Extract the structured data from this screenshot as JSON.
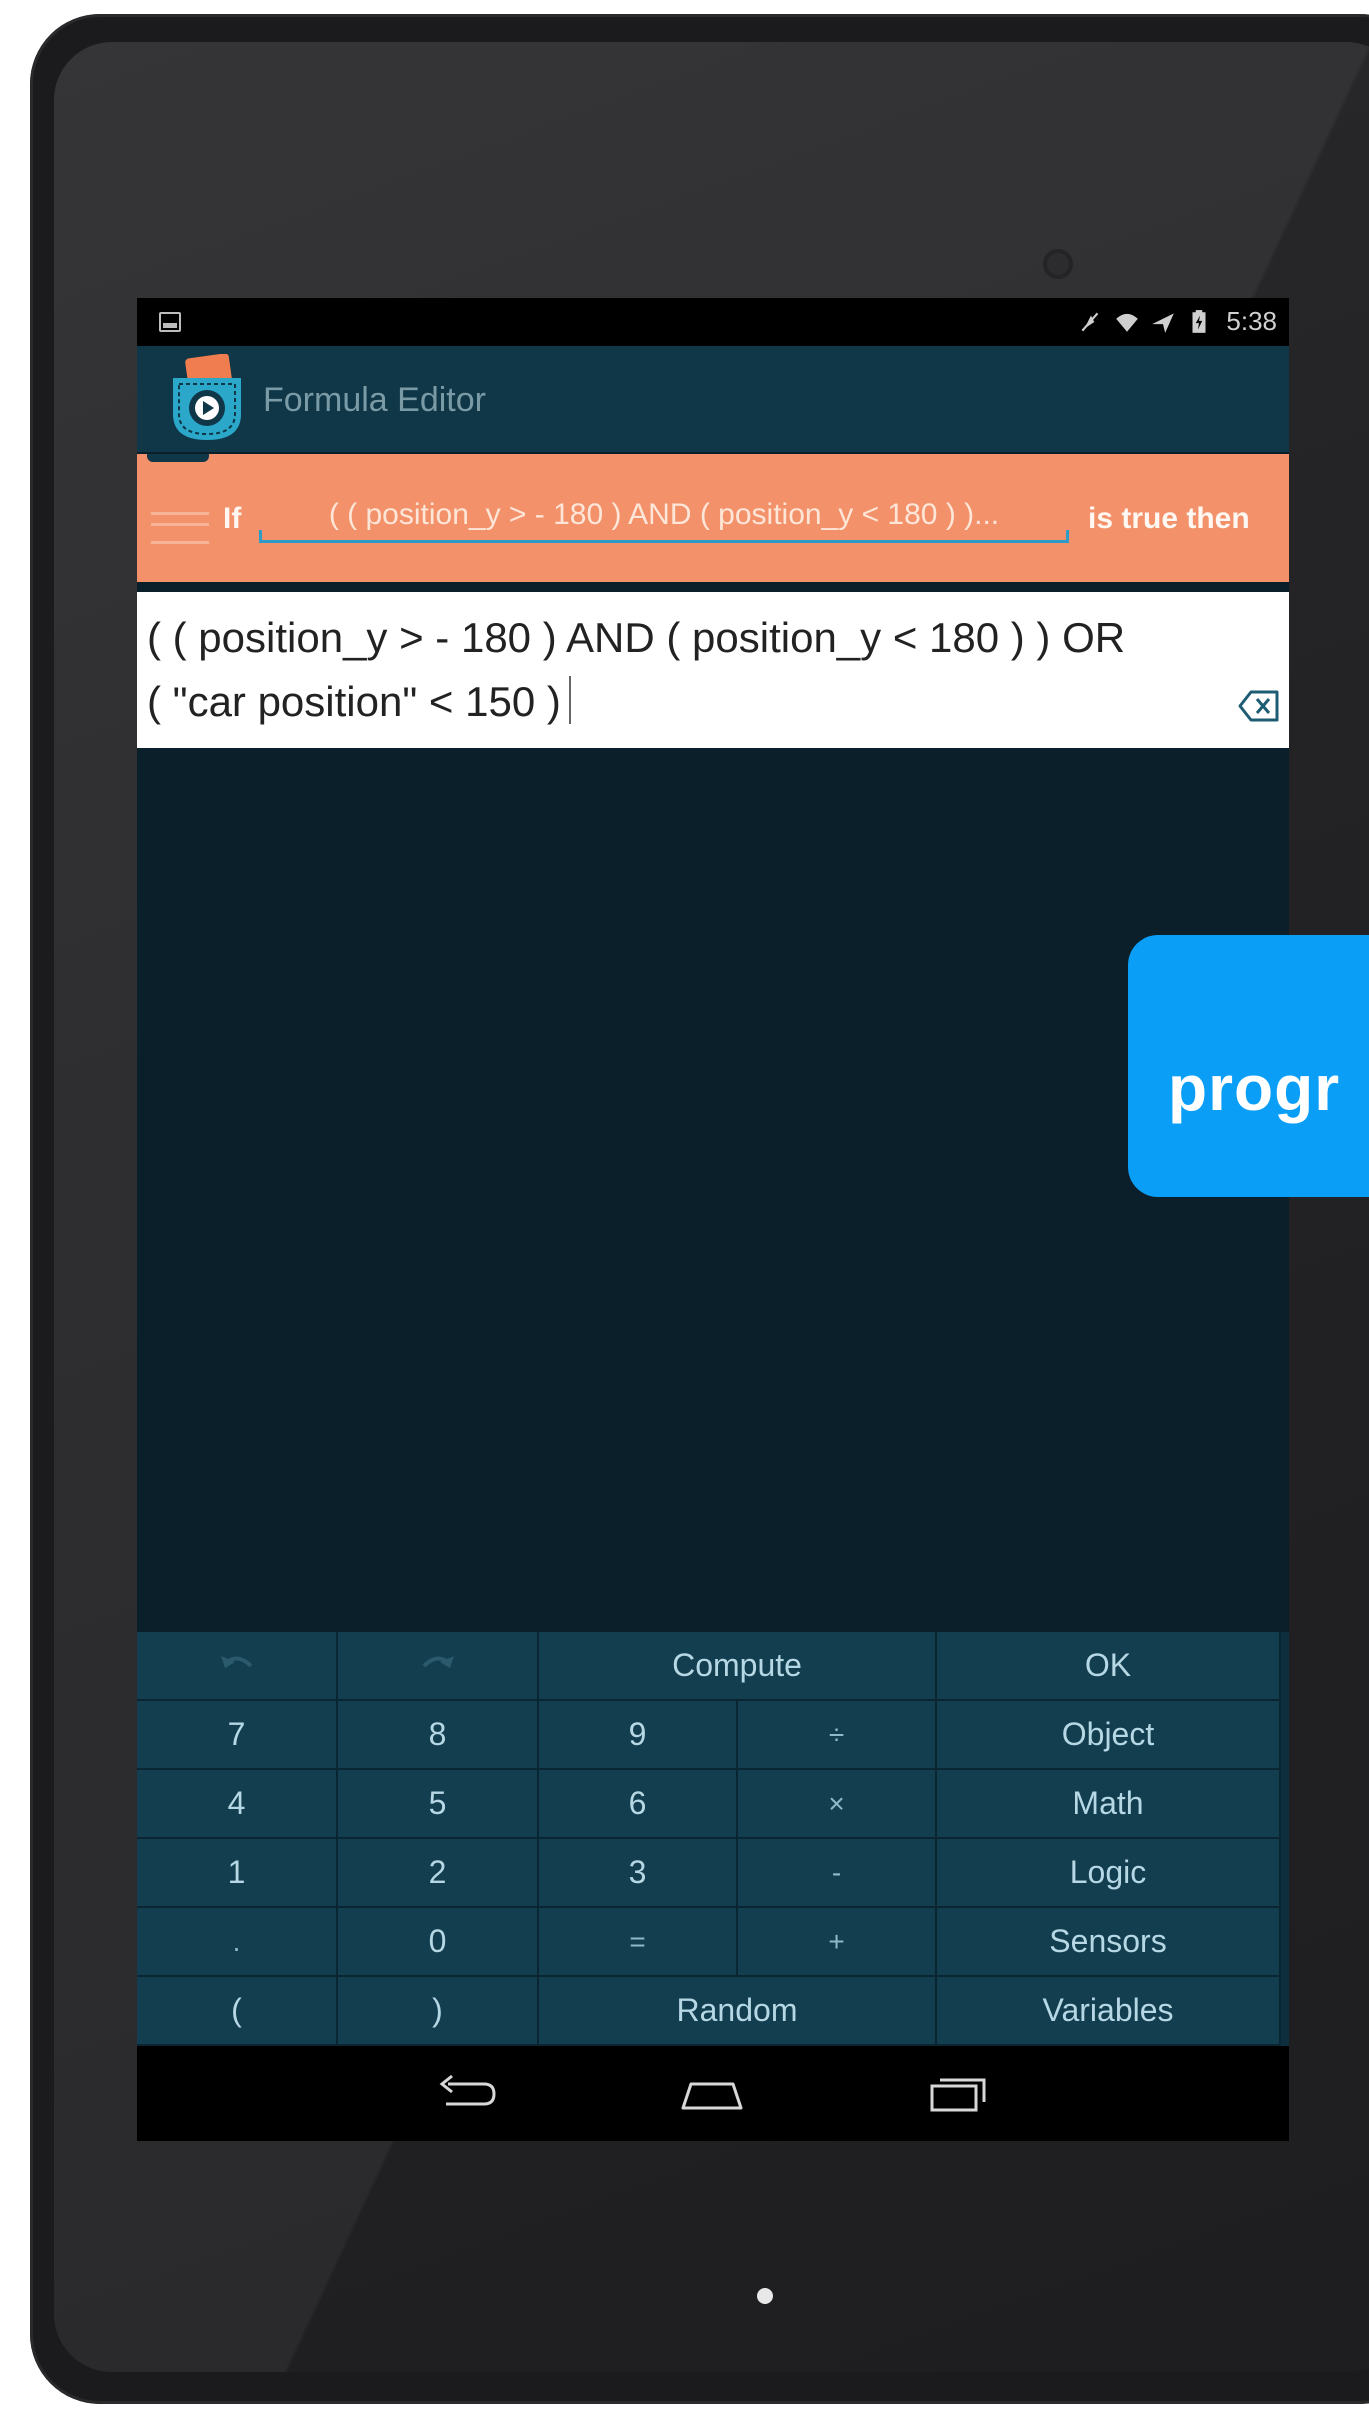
{
  "status_bar": {
    "time": "5:38",
    "icons": [
      "screenshot-icon",
      "mute-icon",
      "wifi-icon",
      "airplane-icon",
      "battery-icon"
    ]
  },
  "action_bar": {
    "title": "Formula Editor",
    "app_icon": "pocket-code-icon"
  },
  "if_brick": {
    "if_label": "If",
    "formula_preview": "( ( position_y > - 180 ) AND ( position_y < 180 ) )...",
    "then_label": "is true then",
    "color": "#f2916a"
  },
  "formula": {
    "line1": "( ( position_y > - 180 ) AND ( position_y < 180 ) ) OR",
    "line2": "( \"car position\" < 150 )"
  },
  "keyboard": {
    "undo_icon": "undo-icon",
    "redo_icon": "redo-icon",
    "compute": "Compute",
    "ok": "OK",
    "rows": [
      [
        "7",
        "8",
        "9",
        "÷",
        "Object"
      ],
      [
        "4",
        "5",
        "6",
        "×",
        "Math"
      ],
      [
        "1",
        "2",
        "3",
        "-",
        "Logic"
      ],
      [
        ".",
        "0",
        "=",
        "+",
        "Sensors"
      ]
    ],
    "open_paren": "(",
    "close_paren": ")",
    "random": "Random",
    "variables": "Variables",
    "accent": "#123e50"
  },
  "nav_bar": {
    "icons": [
      "back-icon",
      "home-icon",
      "recent-apps-icon"
    ]
  },
  "overlay": {
    "text": "progr",
    "color": "#0a9ef7"
  }
}
